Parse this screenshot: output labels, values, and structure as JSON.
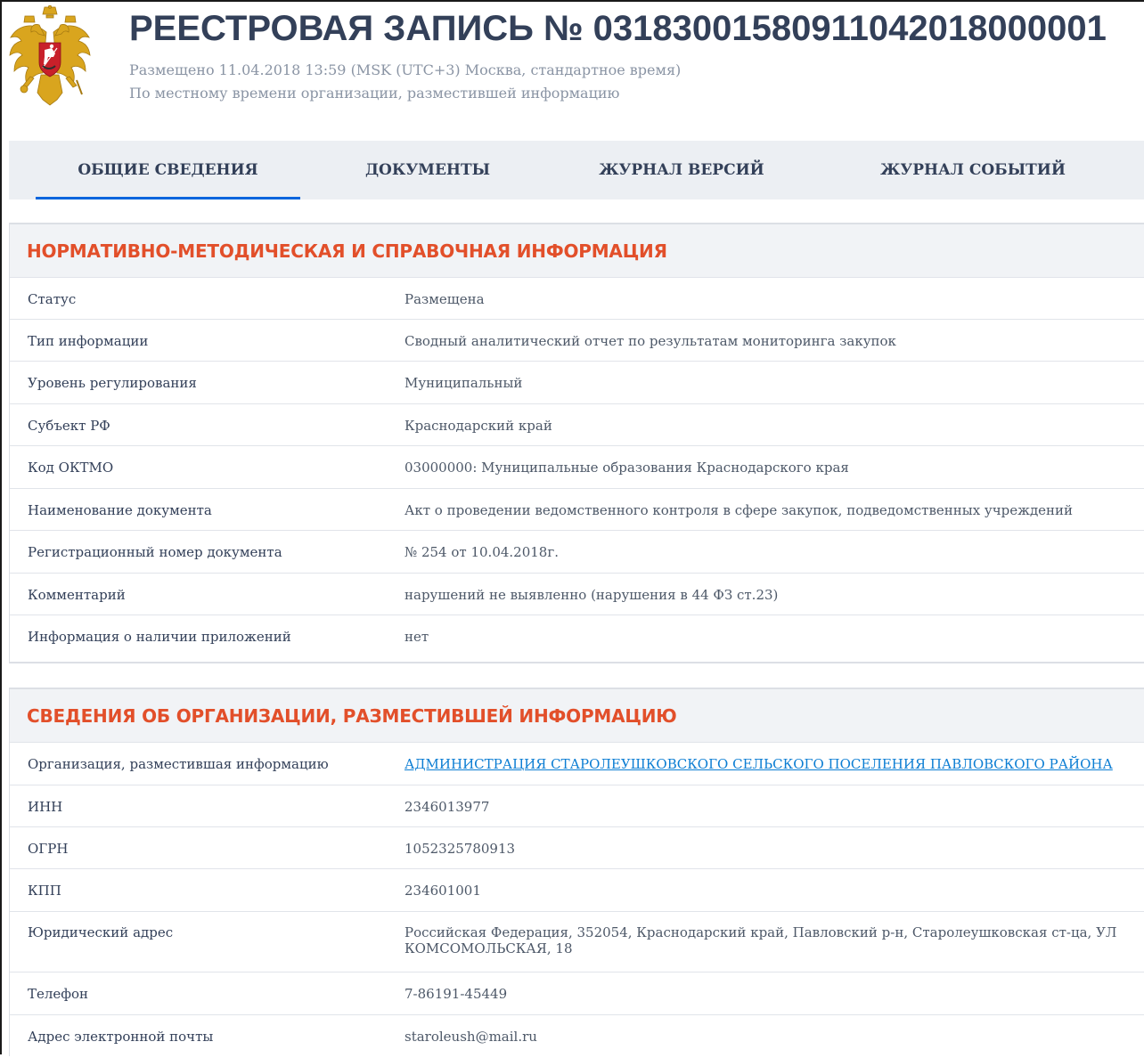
{
  "header": {
    "title": "РЕЕСТРОВАЯ ЗАПИСЬ № 03183001580911042018000001",
    "posted": "Размещено 11.04.2018 13:59 (MSK (UTC+3) Москва, стандартное время)",
    "local_time_note": "По местному времени организации, разместившей информацию",
    "emblem_icon": "russian-coat-of-arms-icon"
  },
  "tabs": [
    {
      "label": "ОБЩИЕ СВЕДЕНИЯ",
      "active": true
    },
    {
      "label": "ДОКУМЕНТЫ",
      "active": false
    },
    {
      "label": "ЖУРНАЛ ВЕРСИЙ",
      "active": false
    },
    {
      "label": "ЖУРНАЛ СОБЫТИЙ",
      "active": false
    }
  ],
  "sections": [
    {
      "title": "НОРМАТИВНО-МЕТОДИЧЕСКАЯ И СПРАВОЧНАЯ ИНФОРМАЦИЯ",
      "rows": [
        {
          "label": "Статус",
          "value": "Размещена"
        },
        {
          "label": "Тип информации",
          "value": "Сводный аналитический отчет по результатам мониторинга закупок"
        },
        {
          "label": "Уровень регулирования",
          "value": "Муниципальный"
        },
        {
          "label": "Субъект РФ",
          "value": "Краснодарский край"
        },
        {
          "label": "Код ОКТМО",
          "value": "03000000: Муниципальные образования Краснодарского края"
        },
        {
          "label": "Наименование документа",
          "value": "Акт о проведении ведомственного контроля в сфере закупок, подведомственных учреждений"
        },
        {
          "label": "Регистрационный номер документа",
          "value": "№ 254 от 10.04.2018г."
        },
        {
          "label": "Комментарий",
          "value": "нарушений не выявленно (нарушения в 44 ФЗ ст.23)"
        },
        {
          "label": "Информация о наличии приложений",
          "value": "нет"
        }
      ]
    },
    {
      "title": "СВЕДЕНИЯ ОБ ОРГАНИЗАЦИИ, РАЗМЕСТИВШЕЙ ИНФОРМАЦИЮ",
      "rows": [
        {
          "label": "Организация, разместившая информацию",
          "value": "АДМИНИСТРАЦИЯ СТАРОЛЕУШКОВСКОГО СЕЛЬСКОГО ПОСЕЛЕНИЯ ПАВЛОВСКОГО РАЙОНА"
        },
        {
          "label": "ИНН",
          "value": "2346013977"
        },
        {
          "label": "ОГРН",
          "value": "1052325780913"
        },
        {
          "label": "КПП",
          "value": "234601001"
        },
        {
          "label": "Юридический адрес",
          "value": "Российская Федерация, 352054, Краснодарский край, Павловский р-н, Старолеушковская ст-ца, УЛ КОМСОМОЛЬСКАЯ, 18"
        },
        {
          "label": "Телефон",
          "value": "7-86191-45449"
        },
        {
          "label": "Адрес электронной почты",
          "value": "staroleush@mail.ru"
        }
      ]
    }
  ],
  "colors": {
    "section_title": "#e24f2a",
    "link": "#0b7dd3",
    "tab_underline": "#0065dd",
    "tab_bar_bg": "#eceff3",
    "section_head_bg": "#f1f3f6"
  }
}
